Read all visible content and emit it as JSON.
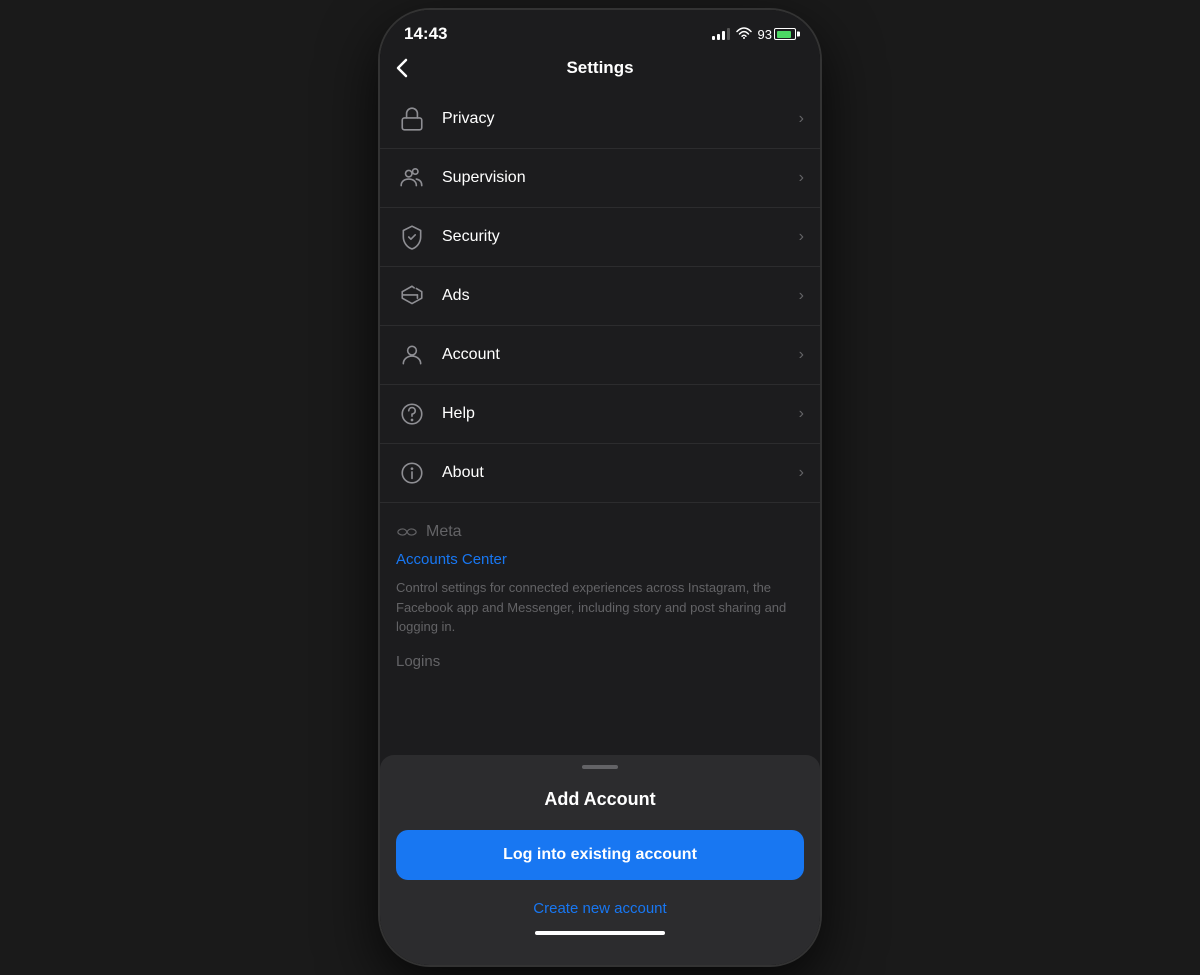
{
  "statusBar": {
    "time": "14:43",
    "battery": "93"
  },
  "header": {
    "title": "Settings",
    "back_label": "‹"
  },
  "settingsItems": [
    {
      "id": "privacy",
      "label": "Privacy",
      "icon": "privacy"
    },
    {
      "id": "supervision",
      "label": "Supervision",
      "icon": "supervision"
    },
    {
      "id": "security",
      "label": "Security",
      "icon": "security"
    },
    {
      "id": "ads",
      "label": "Ads",
      "icon": "ads"
    },
    {
      "id": "account",
      "label": "Account",
      "icon": "account"
    },
    {
      "id": "help",
      "label": "Help",
      "icon": "help"
    },
    {
      "id": "about",
      "label": "About",
      "icon": "about"
    }
  ],
  "metaSection": {
    "logo_text": "Meta",
    "accounts_center_link": "Accounts Center",
    "description": "Control settings for connected experiences across Instagram, the Facebook app and Messenger, including story and post sharing and logging in.",
    "logins_label": "Logins"
  },
  "bottomSheet": {
    "title": "Add Account",
    "login_button_label": "Log into existing account",
    "create_account_label": "Create new account"
  }
}
